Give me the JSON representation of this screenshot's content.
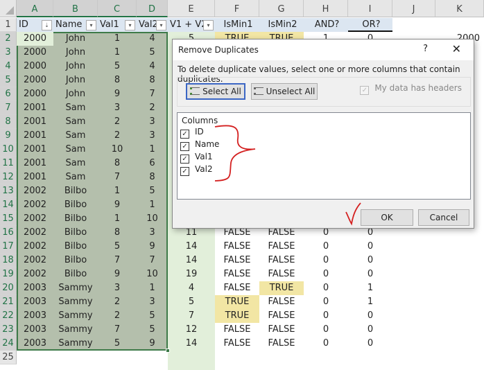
{
  "columns": [
    "A",
    "B",
    "C",
    "D",
    "E",
    "F",
    "G",
    "H",
    "I",
    "J",
    "K"
  ],
  "row_numbers": [
    "1",
    "2",
    "3",
    "4",
    "5",
    "6",
    "7",
    "8",
    "9",
    "10",
    "11",
    "12",
    "13",
    "14",
    "15",
    "16",
    "17",
    "18",
    "19",
    "20",
    "21",
    "22",
    "23",
    "24",
    "25"
  ],
  "table": {
    "headers": [
      "ID",
      "Name",
      "Val1",
      "Val2",
      "V1 + V2",
      "IsMin1",
      "IsMin2",
      "AND?",
      "OR?"
    ],
    "filter_icons": [
      "sort-ascending-filter-icon",
      "filter-dropdown-icon",
      "filter-dropdown-icon",
      "filter-dropdown-icon",
      "filter-dropdown-icon"
    ],
    "rows": [
      [
        "2000",
        "John",
        "1",
        "4",
        "5",
        "TRUE",
        "TRUE",
        "1",
        "0"
      ],
      [
        "2000",
        "John",
        "1",
        "5",
        "",
        "",
        "",
        "",
        ""
      ],
      [
        "2000",
        "John",
        "5",
        "4",
        "",
        "",
        "",
        "",
        ""
      ],
      [
        "2000",
        "John",
        "8",
        "8",
        "",
        "",
        "",
        "",
        ""
      ],
      [
        "2000",
        "John",
        "9",
        "7",
        "",
        "",
        "",
        "",
        ""
      ],
      [
        "2001",
        "Sam",
        "3",
        "2",
        "",
        "",
        "",
        "",
        ""
      ],
      [
        "2001",
        "Sam",
        "2",
        "3",
        "",
        "",
        "",
        "",
        ""
      ],
      [
        "2001",
        "Sam",
        "2",
        "3",
        "",
        "",
        "",
        "",
        ""
      ],
      [
        "2001",
        "Sam",
        "10",
        "1",
        "",
        "",
        "",
        "",
        ""
      ],
      [
        "2001",
        "Sam",
        "8",
        "6",
        "",
        "",
        "",
        "",
        ""
      ],
      [
        "2001",
        "Sam",
        "7",
        "8",
        "",
        "",
        "",
        "",
        ""
      ],
      [
        "2002",
        "Bilbo",
        "1",
        "5",
        "",
        "",
        "",
        "",
        ""
      ],
      [
        "2002",
        "Bilbo",
        "9",
        "1",
        "",
        "",
        "",
        "",
        ""
      ],
      [
        "2002",
        "Bilbo",
        "1",
        "10",
        "",
        "",
        "",
        "",
        ""
      ],
      [
        "2002",
        "Bilbo",
        "8",
        "3",
        "11",
        "FALSE",
        "FALSE",
        "0",
        "0"
      ],
      [
        "2002",
        "Bilbo",
        "5",
        "9",
        "14",
        "FALSE",
        "FALSE",
        "0",
        "0"
      ],
      [
        "2002",
        "Bilbo",
        "7",
        "7",
        "14",
        "FALSE",
        "FALSE",
        "0",
        "0"
      ],
      [
        "2002",
        "Bilbo",
        "9",
        "10",
        "19",
        "FALSE",
        "FALSE",
        "0",
        "0"
      ],
      [
        "2003",
        "Sammy",
        "3",
        "1",
        "4",
        "FALSE",
        "TRUE",
        "0",
        "1"
      ],
      [
        "2003",
        "Sammy",
        "2",
        "3",
        "5",
        "TRUE",
        "FALSE",
        "0",
        "1"
      ],
      [
        "2003",
        "Sammy",
        "2",
        "5",
        "7",
        "TRUE",
        "FALSE",
        "0",
        "0"
      ],
      [
        "2003",
        "Sammy",
        "7",
        "5",
        "12",
        "FALSE",
        "FALSE",
        "0",
        "0"
      ],
      [
        "2003",
        "Sammy",
        "5",
        "9",
        "14",
        "FALSE",
        "FALSE",
        "0",
        "0"
      ]
    ],
    "k2_value": "2000"
  },
  "dialog": {
    "title": "Remove Duplicates",
    "help": "?",
    "close": "✕",
    "instructions": "To delete duplicate values, select one or more columns that contain duplicates.",
    "select_all": "Select All",
    "unselect_all": "Unselect All",
    "has_headers_label": "My data has headers",
    "has_headers_checked": true,
    "columns_label": "Columns",
    "columns": [
      {
        "label": "ID",
        "checked": true
      },
      {
        "label": "Name",
        "checked": true
      },
      {
        "label": "Val1",
        "checked": true
      },
      {
        "label": "Val2",
        "checked": true
      }
    ],
    "ok": "OK",
    "cancel": "Cancel"
  },
  "colors": {
    "selection": "#b4bfac",
    "selection_border": "#3e7a49",
    "header_fill": "#dce6f1",
    "highlight_true": "#f2e6a4",
    "column_e_fill": "#e2efda",
    "annotation_red": "#d42020"
  }
}
